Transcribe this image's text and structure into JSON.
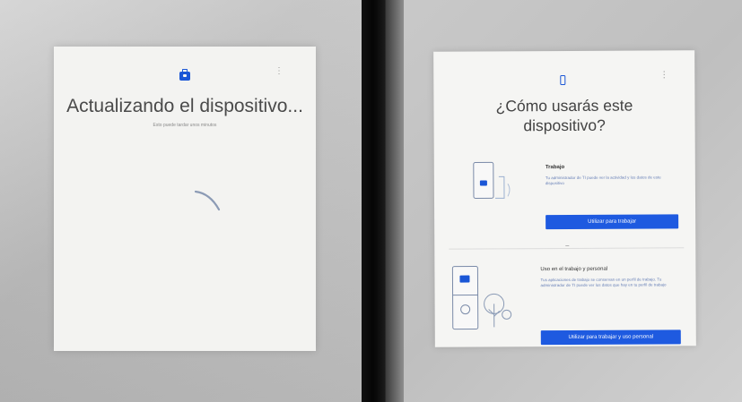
{
  "left_screen": {
    "title": "Actualizando el dispositivo...",
    "subtitle": "Esto puede tardar unos minutos",
    "icons": {
      "top": "briefcase-icon",
      "menu": "more-vert-icon",
      "progress": "spinner-icon"
    }
  },
  "right_screen": {
    "title_line1": "¿Cómo usarás este",
    "title_line2": "dispositivo?",
    "icons": {
      "top": "phone-icon",
      "menu": "more-vert-icon"
    },
    "work_option": {
      "title": "Trabajo",
      "description": "Tu administrador de TI puede ver la actividad y los datos de este dispositivo",
      "button": "Utilizar para trabajar"
    },
    "personal_option": {
      "title": "Uso en el trabajo y personal",
      "description": "Tus aplicaciones de trabajo se conservan en un perfil de trabajo. Tu administrador de TI puede ver los datos que hay en tu perfil de trabajo",
      "button": "Utilizar para trabajar y uso personal"
    }
  },
  "colors": {
    "accent": "#1e5ae0",
    "screen_bg": "#f3f3f1"
  }
}
